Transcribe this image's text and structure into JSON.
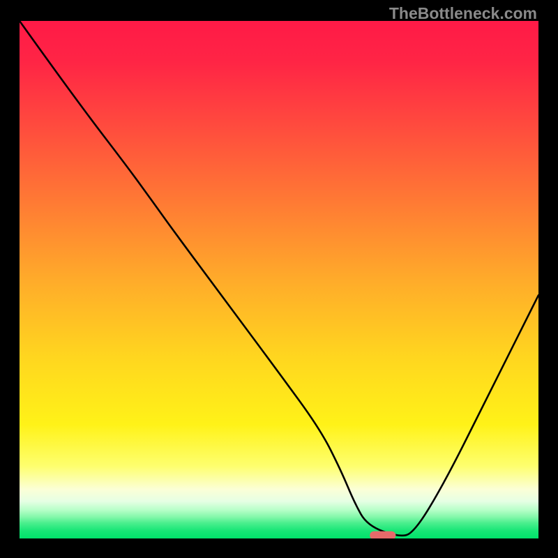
{
  "watermark": "TheBottleneck.com",
  "chart_data": {
    "type": "line",
    "title": "",
    "xlabel": "",
    "ylabel": "",
    "xlim": [
      0,
      100
    ],
    "ylim": [
      0,
      100
    ],
    "background_gradient": {
      "stops": [
        {
          "offset": 0.0,
          "color": "#ff1a47"
        },
        {
          "offset": 0.08,
          "color": "#ff2545"
        },
        {
          "offset": 0.2,
          "color": "#ff4a3e"
        },
        {
          "offset": 0.35,
          "color": "#ff7a34"
        },
        {
          "offset": 0.5,
          "color": "#ffab2a"
        },
        {
          "offset": 0.65,
          "color": "#ffd61f"
        },
        {
          "offset": 0.78,
          "color": "#fff218"
        },
        {
          "offset": 0.86,
          "color": "#feff6e"
        },
        {
          "offset": 0.905,
          "color": "#fbffd6"
        },
        {
          "offset": 0.928,
          "color": "#e6ffe4"
        },
        {
          "offset": 0.945,
          "color": "#b7ffc8"
        },
        {
          "offset": 0.958,
          "color": "#85f8ab"
        },
        {
          "offset": 0.97,
          "color": "#4bef8e"
        },
        {
          "offset": 0.985,
          "color": "#18e676"
        },
        {
          "offset": 1.0,
          "color": "#00e26b"
        }
      ]
    },
    "series": [
      {
        "name": "bottleneck-curve",
        "color": "#000000",
        "x": [
          0.0,
          5.0,
          13.0,
          21.0,
          25.5,
          30.0,
          40.0,
          50.0,
          58.0,
          62.0,
          64.5,
          67.0,
          73.0,
          76.0,
          82.0,
          90.0,
          100.0
        ],
        "values": [
          100.0,
          93.0,
          82.0,
          71.5,
          65.3,
          59.0,
          45.5,
          32.0,
          21.0,
          13.0,
          7.0,
          2.5,
          0.3,
          1.0,
          11.0,
          27.0,
          47.0
        ]
      }
    ],
    "marker": {
      "name": "optimal-marker",
      "x": 70.0,
      "y": 0.6,
      "width": 5.0,
      "height": 1.6,
      "color": "#e66a6a"
    }
  }
}
